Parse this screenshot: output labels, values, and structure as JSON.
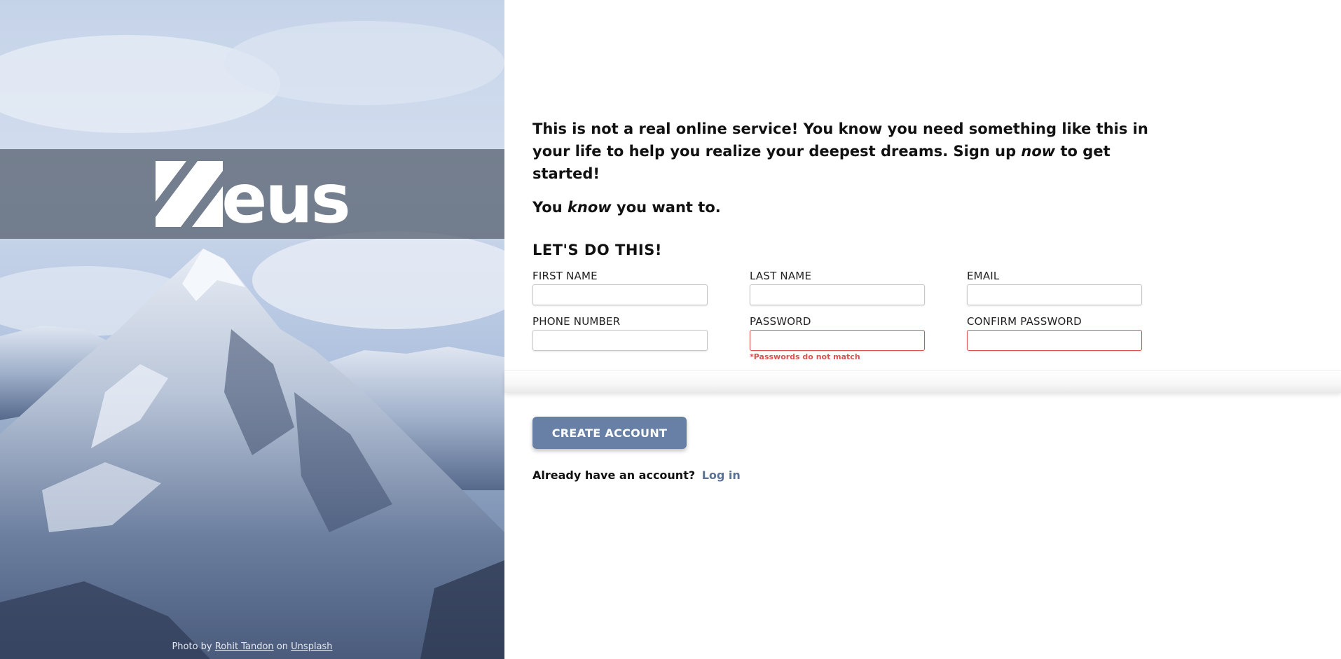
{
  "brand": {
    "name": "eus"
  },
  "hero": {
    "credit_prefix": "Photo by",
    "credit_author": "Rohit Tandon",
    "credit_on": "on",
    "credit_site": "Unsplash"
  },
  "intro": {
    "line1_a": "This is not a real online service! You know you need something like this in your life to help you realize your deepest dreams. Sign up",
    "line1_em": "now",
    "line1_b": "to get started!",
    "line2_a": "You",
    "line2_em": "know",
    "line2_b": "you want to."
  },
  "form": {
    "title": "LET'S DO THIS!",
    "fields": {
      "first_name": {
        "label": "FIRST NAME",
        "value": ""
      },
      "last_name": {
        "label": "LAST NAME",
        "value": ""
      },
      "email": {
        "label": "EMAIL",
        "value": ""
      },
      "phone": {
        "label": "PHONE NUMBER",
        "value": ""
      },
      "password": {
        "label": "PASSWORD",
        "value": ""
      },
      "confirm_password": {
        "label": "CONFIRM PASSWORD",
        "value": ""
      }
    },
    "error": "*Passwords do not match",
    "submit_label": "CREATE ACCOUNT",
    "login_prompt": "Already have an account?",
    "login_link": "Log in"
  },
  "colors": {
    "accent": "#6880a5",
    "error": "#d9534f",
    "link": "#5b7196"
  }
}
